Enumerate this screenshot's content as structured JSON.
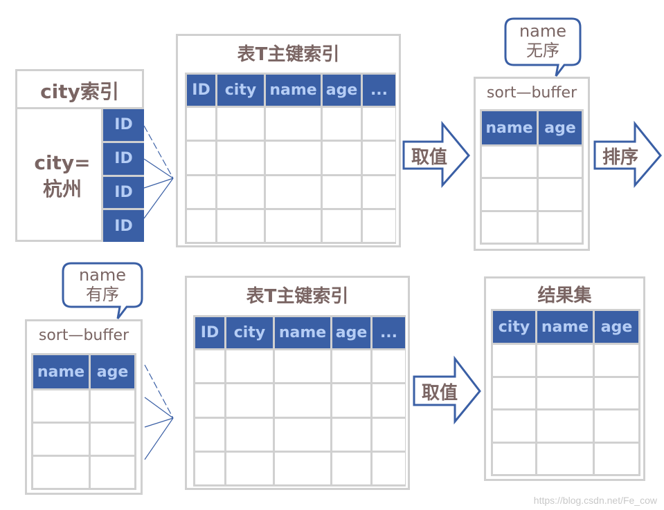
{
  "city_index": {
    "title": "city索引",
    "condition_line1": "city=",
    "condition_line2": "杭州",
    "ids": [
      "ID",
      "ID",
      "ID",
      "ID"
    ]
  },
  "primary_index_top": {
    "title": "表T主键索引",
    "columns": [
      "ID",
      "city",
      "name",
      "age",
      "..."
    ],
    "row_count": 4
  },
  "arrow_fetch_top": {
    "label": "取值"
  },
  "bubble_unsorted": {
    "line1": "name",
    "line2": "无序"
  },
  "sort_buffer_top": {
    "title": "sort—buffer",
    "columns": [
      "name",
      "age"
    ],
    "row_count": 3
  },
  "arrow_sort": {
    "label": "排序"
  },
  "bubble_sorted": {
    "line1": "name",
    "line2": "有序"
  },
  "sort_buffer_bottom": {
    "title": "sort—buffer",
    "columns": [
      "name",
      "age"
    ],
    "row_count": 3
  },
  "primary_index_bottom": {
    "title": "表T主键索引",
    "columns": [
      "ID",
      "city",
      "name",
      "age",
      "..."
    ],
    "row_count": 4
  },
  "arrow_fetch_bottom": {
    "label": "取值"
  },
  "result_set": {
    "title": "结果集",
    "columns": [
      "city",
      "name",
      "age"
    ],
    "row_count": 4
  },
  "watermark": "https://blog.csdn.net/Fe_cow",
  "colors": {
    "header_fill": "#3a5fa5",
    "header_text": "#b5cdf5",
    "label_text": "#7a6563",
    "border_gray": "#d0d0d0",
    "arrow_stroke": "#3a5fa5"
  }
}
